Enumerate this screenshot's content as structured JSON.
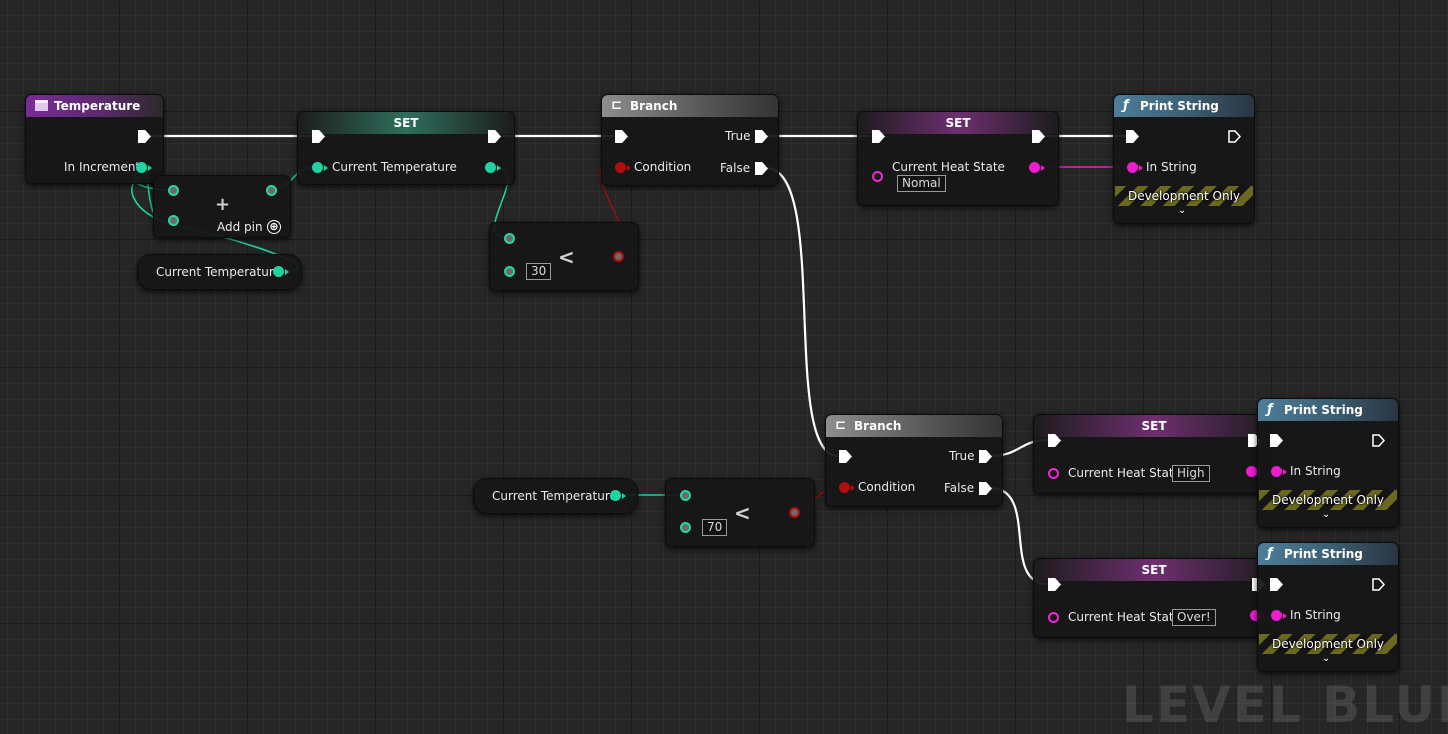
{
  "graph": {
    "watermark": "LEVEL BLUEP",
    "colors": {
      "exec_wire": "#ffffff",
      "float_wire": "#1fd3a3",
      "string_wire": "#f01ad0",
      "bool_wire": "#b30d0d"
    }
  },
  "nodes": {
    "temperature": {
      "title": "Temperature",
      "icon": "function-entry-icon",
      "pin_label": "In Increment"
    },
    "add": {
      "symbol": "+",
      "add_pin_label": "Add pin",
      "add_pin_icon": "⊕"
    },
    "get_temp_1": {
      "label": "Current Temperature"
    },
    "set_temp": {
      "title": "SET",
      "pin_label": "Current Temperature"
    },
    "less_1": {
      "symbol": "<",
      "value": "30"
    },
    "branch_1": {
      "title": "Branch",
      "icon": "branch-icon",
      "condition": "Condition",
      "true_label": "True",
      "false_label": "False"
    },
    "set_state_normal": {
      "title": "SET",
      "pin_label": "Current Heat State",
      "value": "Nomal"
    },
    "print_1": {
      "title": "Print String",
      "icon": "function-icon",
      "pin_label": "In String",
      "dev_label": "Development Only"
    },
    "get_temp_2": {
      "label": "Current Temperature"
    },
    "less_2": {
      "symbol": "<",
      "value": "70"
    },
    "branch_2": {
      "title": "Branch",
      "icon": "branch-icon",
      "condition": "Condition",
      "true_label": "True",
      "false_label": "False"
    },
    "set_state_high": {
      "title": "SET",
      "pin_label": "Current Heat State",
      "value": "High"
    },
    "set_state_over": {
      "title": "SET",
      "pin_label": "Current Heat State",
      "value": "Over!"
    },
    "print_2": {
      "title": "Print String",
      "icon": "function-icon",
      "pin_label": "In String",
      "dev_label": "Development Only"
    },
    "print_3": {
      "title": "Print String",
      "icon": "function-icon",
      "pin_label": "In String",
      "dev_label": "Development Only"
    }
  }
}
